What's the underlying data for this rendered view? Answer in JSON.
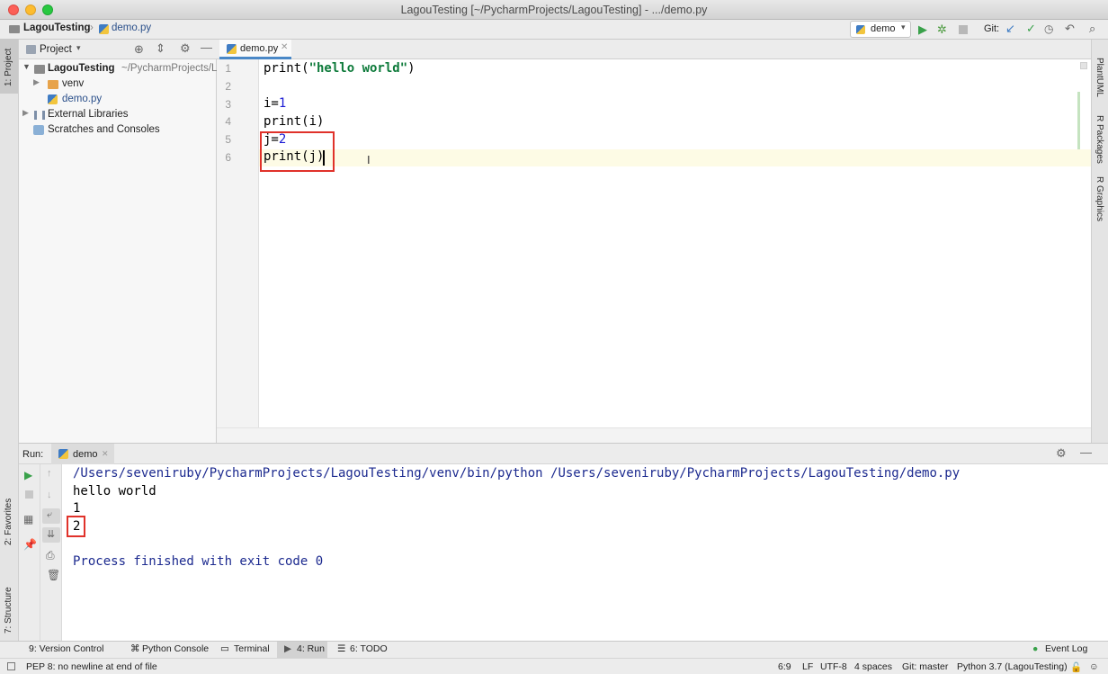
{
  "window": {
    "title": "LagouTesting [~/PycharmProjects/LagouTesting] - .../demo.py"
  },
  "nav": {
    "project": "LagouTesting",
    "file": "demo.py",
    "run_config": "demo",
    "git_label": "Git:"
  },
  "left_strip": {
    "project": "1: Project",
    "favorites": "2: Favorites",
    "structure": "7: Structure"
  },
  "right_strip": {
    "plantuml": "PlantUML",
    "rpackages": "R Packages",
    "rgraphics": "R Graphics"
  },
  "project_panel": {
    "title": "Project",
    "tree": [
      {
        "label": "LagouTesting",
        "suffix": "~/PycharmProjects/L"
      },
      {
        "label": "venv"
      },
      {
        "label": "demo.py"
      },
      {
        "label": "External Libraries"
      },
      {
        "label": "Scratches and Consoles"
      }
    ]
  },
  "editor": {
    "tab": "demo.py",
    "line_numbers": [
      "1",
      "2",
      "3",
      "4",
      "5",
      "6"
    ],
    "lines": {
      "l1_fn": "print(",
      "l1_str": "\"hello world\"",
      "l1_end": ")",
      "l3_a": "i=",
      "l3_n": "1",
      "l4": "print(i)",
      "l5_a": "j=",
      "l5_n": "2",
      "l6": "print(j)"
    }
  },
  "run_panel": {
    "label": "Run:",
    "tab": "demo",
    "output": [
      "/Users/seveniruby/PycharmProjects/LagouTesting/venv/bin/python /Users/seveniruby/PycharmProjects/LagouTesting/demo.py",
      "hello world",
      "1",
      "2",
      "",
      "Process finished with exit code 0"
    ]
  },
  "tool_windows": {
    "version_control": "9: Version Control",
    "python_console": "Python Console",
    "terminal": "Terminal",
    "run": "4: Run",
    "todo": "6: TODO",
    "event_log": "Event Log"
  },
  "status": {
    "message": "PEP 8: no newline at end of file",
    "position": "6:9",
    "line_sep": "LF",
    "encoding": "UTF-8",
    "indent": "4 spaces",
    "git": "Git: master",
    "interpreter": "Python 3.7 (LagouTesting)"
  },
  "colors": {
    "close": "#fc5f57",
    "minimize": "#fdbc2e",
    "maximize": "#28c840",
    "highlight_box": "#e0322a",
    "number": "#1a1ad4",
    "string": "#0d7a3a"
  }
}
